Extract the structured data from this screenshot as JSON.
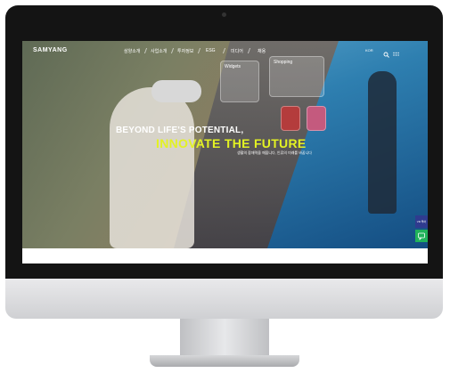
{
  "site": {
    "logo": "SAMYANG",
    "nav": [
      {
        "label": "삼양소개"
      },
      {
        "label": "사업소개"
      },
      {
        "label": "투자정보"
      },
      {
        "label": "ESG"
      },
      {
        "label": "미디어"
      },
      {
        "label": "채용"
      }
    ],
    "lang": "KOR",
    "icons": [
      "search-icon",
      "menu-grid-icon"
    ]
  },
  "hero": {
    "headline_1": "BEYOND LIFE'S POTENTIAL,",
    "headline_2": "INNOVATE THE FUTURE",
    "subline": "생활의 잠재력을 깨웁니다, 인류의 미래를 바꿉니다",
    "headline_2_color": "#e3f223",
    "cards": [
      {
        "label": "Widgets"
      },
      {
        "label": "Shopping"
      }
    ]
  },
  "side_buttons": [
    {
      "label": "VR\n투어",
      "color": "#2f3b8f"
    },
    {
      "label": "",
      "icon": "chat-icon",
      "color": "#20b25a"
    }
  ]
}
